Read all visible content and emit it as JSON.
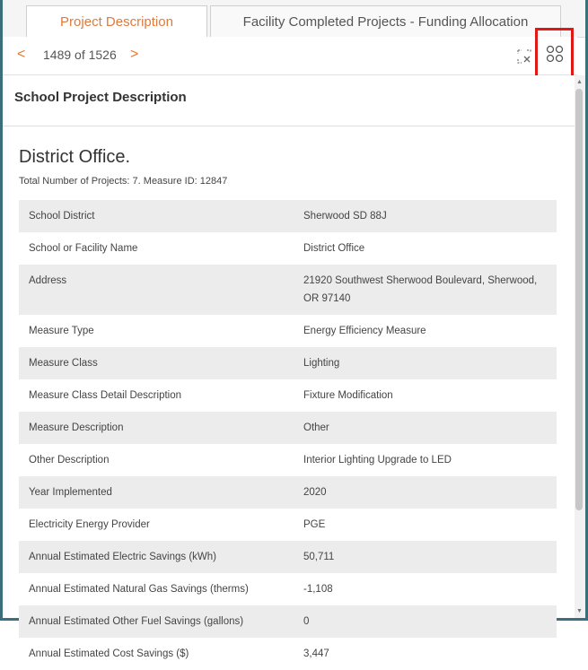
{
  "tabs": [
    {
      "label": "Project Description",
      "active": true
    },
    {
      "label": "Facility Completed Projects - Funding Allocation",
      "active": false
    }
  ],
  "pager": {
    "prev": "<",
    "next": ">",
    "count": "1489 of 1526"
  },
  "icons": {
    "clear_selection": "clear-selection-icon",
    "expand": "expand-icon"
  },
  "colors": {
    "accent": "#e07a3b",
    "frame": "#3b6f79",
    "highlight": "#e01818"
  },
  "section": {
    "title": "School Project Description"
  },
  "record": {
    "title": "District Office.",
    "subtitle": "Total Number of Projects: 7. Measure ID: 12847",
    "rows": [
      {
        "key": "School District",
        "value": "Sherwood SD 88J"
      },
      {
        "key": "School or Facility Name",
        "value": "District Office"
      },
      {
        "key": "Address",
        "value": "21920 Southwest Sherwood Boulevard, Sherwood, OR 97140"
      },
      {
        "key": "Measure Type",
        "value": "Energy Efficiency Measure"
      },
      {
        "key": "Measure Class",
        "value": "Lighting"
      },
      {
        "key": "Measure Class Detail Description",
        "value": "Fixture Modification"
      },
      {
        "key": "Measure Description",
        "value": "Other"
      },
      {
        "key": "Other Description",
        "value": "Interior Lighting Upgrade to LED"
      },
      {
        "key": "Year Implemented",
        "value": "2020"
      },
      {
        "key": "Electricity Energy Provider",
        "value": "PGE"
      },
      {
        "key": "Annual Estimated Electric Savings (kWh)",
        "value": "50,711"
      },
      {
        "key": "Annual Estimated Natural Gas Savings (therms)",
        "value": "-1,108"
      },
      {
        "key": "Annual Estimated Other Fuel Savings (gallons)",
        "value": "0"
      },
      {
        "key": "Annual Estimated Cost Savings ($)",
        "value": "3,447"
      }
    ]
  }
}
